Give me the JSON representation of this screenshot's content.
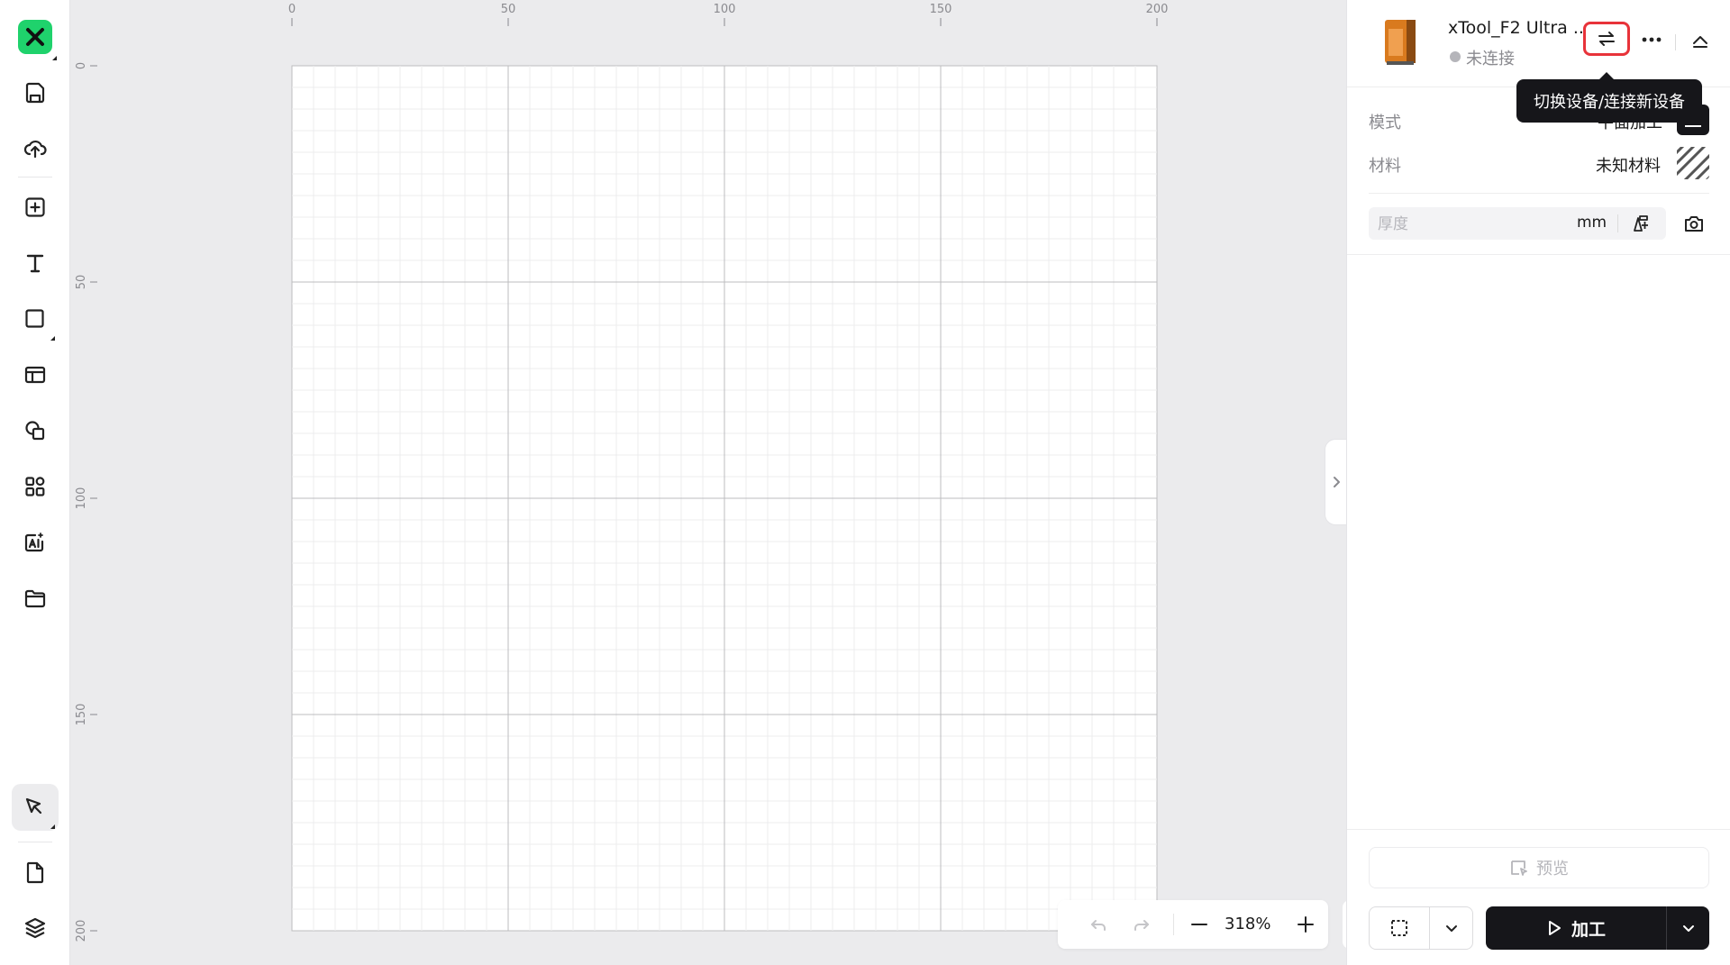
{
  "app": {
    "logo": "xtool-x-logo"
  },
  "left_toolbar": {
    "items": [
      {
        "icon": "save-icon"
      },
      {
        "icon": "cloud-upload-icon"
      },
      {
        "icon": "add-icon"
      },
      {
        "icon": "text-icon"
      },
      {
        "icon": "shape-icon"
      },
      {
        "icon": "layout-icon"
      },
      {
        "icon": "copy-shapes-icon"
      },
      {
        "icon": "apps-icon"
      },
      {
        "icon": "ai-icon"
      },
      {
        "icon": "folder-icon"
      },
      {
        "icon": "select-pen-icon"
      },
      {
        "icon": "document-icon"
      },
      {
        "icon": "layers-icon"
      }
    ]
  },
  "rulers": {
    "top_labels": [
      "0",
      "50",
      "100",
      "150",
      "200"
    ],
    "left_labels": [
      "0",
      "50",
      "100",
      "150",
      "200"
    ]
  },
  "canvas": {
    "workspace_mm": [
      200,
      200
    ],
    "minor_grid_mm": 5,
    "major_grid_mm": 50
  },
  "zoom_bar": {
    "zoom": "318%",
    "undo_icon": "undo-icon",
    "redo_icon": "redo-icon",
    "zoom_out_icon": "minus-icon",
    "zoom_in_icon": "plus-icon"
  },
  "device": {
    "name": "xTool_F2 Ultra ...",
    "status": "未连接",
    "status_color": "#b5b5ba",
    "switch_tooltip": "切换设备/连接新设备",
    "highlight_color": "#e8333a"
  },
  "settings": {
    "mode_label": "模式",
    "mode_value": "平面加工",
    "material_label": "材料",
    "material_value": "未知材料",
    "thickness_placeholder": "厚度",
    "thickness_value": "",
    "thickness_unit": "mm"
  },
  "actions": {
    "preview_label": "预览",
    "process_label": "加工",
    "primary_color": "#16161a",
    "accent_color": "#1fd26c"
  }
}
